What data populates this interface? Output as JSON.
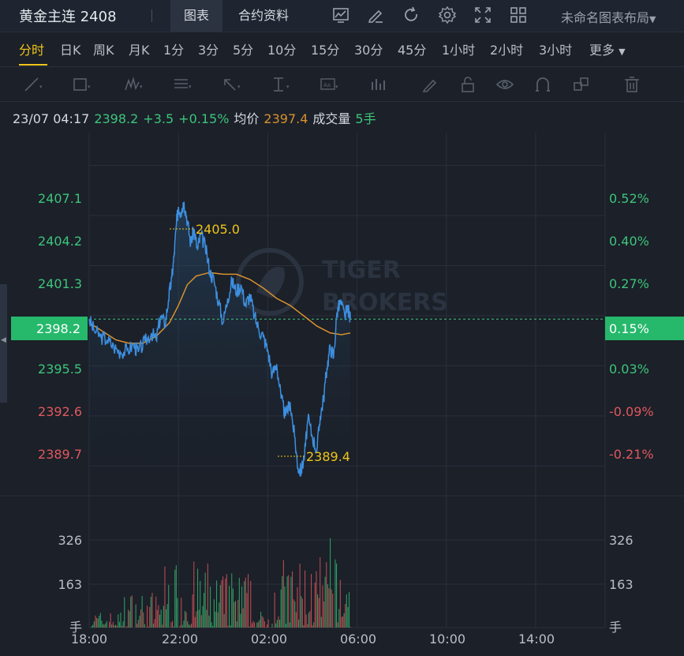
{
  "header": {
    "title": "黄金主连 2408",
    "tabs": [
      "图表",
      "合约资料"
    ],
    "active_tab": "图表",
    "icons": [
      "indicator-icon",
      "draw-icon",
      "refresh-icon",
      "settings-icon",
      "fullscreen-icon",
      "layout-grid-icon"
    ],
    "layout_name": "未命名图表布局"
  },
  "periods": [
    "分时",
    "日K",
    "周K",
    "月K",
    "1分",
    "3分",
    "5分",
    "10分",
    "15分",
    "30分",
    "45分",
    "1小时",
    "2小时",
    "3小时",
    "更多"
  ],
  "active_period": "分时",
  "drawing_tools": [
    "line-tool-icon",
    "rect-tool-icon",
    "wave-tool-icon",
    "fib-tool-icon",
    "arrow-tool-icon",
    "measure-tool-icon",
    "text-tool-icon",
    "bars-tool-icon",
    "pen-icon",
    "lock-icon",
    "eye-icon",
    "magnet-icon",
    "layers-icon",
    "trash-icon"
  ],
  "info_bar": {
    "datetime": "23/07 04:17",
    "price": "2398.2",
    "change": "+3.5",
    "change_pct": "+0.15%",
    "avg_label": "均价",
    "avg_value": "2397.4",
    "volume_label": "成交量",
    "volume_value": "5手"
  },
  "watermark": [
    "TIGER",
    "BROKERS"
  ],
  "colors": {
    "up": "#3ec47a",
    "down": "#e0585e",
    "price_line": "#3d8fe0",
    "avg_line": "#d9912e",
    "highlight": "#f0c419",
    "current_box": "#26b86b"
  },
  "chart_data": {
    "type": "line",
    "price_ticks_left": [
      "2407.1",
      "2404.2",
      "2401.3",
      "2398.2",
      "2395.5",
      "2392.6",
      "2389.7"
    ],
    "price_ticks_values": [
      2407.1,
      2404.2,
      2401.3,
      2398.4,
      2395.5,
      2392.6,
      2389.7
    ],
    "pct_ticks_right": [
      "0.52%",
      "0.40%",
      "0.27%",
      "0.15%",
      "0.03%",
      "-0.09%",
      "-0.21%"
    ],
    "current_price": "2398.2",
    "current_pct": "0.15%",
    "high_label": "2405.0",
    "low_label": "2389.4",
    "ylim": [
      2388.25,
      2409.0
    ],
    "x_labels": [
      "18:00",
      "22:00",
      "02:00",
      "06:00",
      "10:00",
      "14:00"
    ],
    "volume_ticks": [
      "326",
      "163"
    ],
    "volume_unit": "手",
    "price_series": [
      {
        "t": 18.0,
        "p": 2398.2
      },
      {
        "t": 18.2,
        "p": 2397.6
      },
      {
        "t": 18.5,
        "p": 2397.2
      },
      {
        "t": 18.8,
        "p": 2397.0
      },
      {
        "t": 19.1,
        "p": 2396.6
      },
      {
        "t": 19.4,
        "p": 2396.3
      },
      {
        "t": 19.7,
        "p": 2396.4
      },
      {
        "t": 20.0,
        "p": 2396.7
      },
      {
        "t": 20.2,
        "p": 2396.3
      },
      {
        "t": 20.5,
        "p": 2396.9
      },
      {
        "t": 20.8,
        "p": 2397.4
      },
      {
        "t": 21.0,
        "p": 2397.0
      },
      {
        "t": 21.2,
        "p": 2398.4
      },
      {
        "t": 21.4,
        "p": 2397.9
      },
      {
        "t": 21.55,
        "p": 2399.3
      },
      {
        "t": 21.7,
        "p": 2400.6
      },
      {
        "t": 21.8,
        "p": 2401.8
      },
      {
        "t": 21.9,
        "p": 2403.6
      },
      {
        "t": 22.0,
        "p": 2404.7
      },
      {
        "t": 22.1,
        "p": 2404.4
      },
      {
        "t": 22.25,
        "p": 2405.0
      },
      {
        "t": 22.4,
        "p": 2403.9
      },
      {
        "t": 22.55,
        "p": 2402.6
      },
      {
        "t": 22.7,
        "p": 2403.4
      },
      {
        "t": 22.85,
        "p": 2402.2
      },
      {
        "t": 23.0,
        "p": 2403.1
      },
      {
        "t": 23.2,
        "p": 2402.4
      },
      {
        "t": 23.4,
        "p": 2401.0
      },
      {
        "t": 23.6,
        "p": 2400.4
      },
      {
        "t": 23.8,
        "p": 2399.2
      },
      {
        "t": 24.0,
        "p": 2398.0
      },
      {
        "t": 24.2,
        "p": 2399.4
      },
      {
        "t": 24.4,
        "p": 2400.4
      },
      {
        "t": 24.6,
        "p": 2399.8
      },
      {
        "t": 24.8,
        "p": 2400.2
      },
      {
        "t": 25.0,
        "p": 2399.0
      },
      {
        "t": 25.2,
        "p": 2399.6
      },
      {
        "t": 25.4,
        "p": 2398.4
      },
      {
        "t": 25.6,
        "p": 2397.6
      },
      {
        "t": 25.8,
        "p": 2397.2
      },
      {
        "t": 26.0,
        "p": 2396.4
      },
      {
        "t": 26.2,
        "p": 2395.0
      },
      {
        "t": 26.4,
        "p": 2395.6
      },
      {
        "t": 26.6,
        "p": 2393.6
      },
      {
        "t": 26.8,
        "p": 2392.6
      },
      {
        "t": 27.0,
        "p": 2393.4
      },
      {
        "t": 27.2,
        "p": 2391.4
      },
      {
        "t": 27.35,
        "p": 2389.6
      },
      {
        "t": 27.5,
        "p": 2389.4
      },
      {
        "t": 27.65,
        "p": 2390.4
      },
      {
        "t": 27.8,
        "p": 2392.4
      },
      {
        "t": 28.0,
        "p": 2391.4
      },
      {
        "t": 28.2,
        "p": 2390.6
      },
      {
        "t": 28.35,
        "p": 2392.6
      },
      {
        "t": 28.5,
        "p": 2393.6
      },
      {
        "t": 28.65,
        "p": 2395.4
      },
      {
        "t": 28.8,
        "p": 2396.6
      },
      {
        "t": 28.95,
        "p": 2396.0
      },
      {
        "t": 29.1,
        "p": 2398.6
      },
      {
        "t": 29.25,
        "p": 2399.2
      },
      {
        "t": 29.45,
        "p": 2398.4
      },
      {
        "t": 29.6,
        "p": 2398.8
      },
      {
        "t": 29.7,
        "p": 2398.2
      }
    ],
    "avg_series": [
      {
        "t": 18.0,
        "p": 2398.0
      },
      {
        "t": 18.6,
        "p": 2397.5
      },
      {
        "t": 19.2,
        "p": 2397.0
      },
      {
        "t": 19.8,
        "p": 2396.8
      },
      {
        "t": 20.4,
        "p": 2396.8
      },
      {
        "t": 21.0,
        "p": 2397.2
      },
      {
        "t": 21.6,
        "p": 2398.0
      },
      {
        "t": 22.0,
        "p": 2399.0
      },
      {
        "t": 22.4,
        "p": 2400.2
      },
      {
        "t": 22.8,
        "p": 2400.7
      },
      {
        "t": 23.4,
        "p": 2400.9
      },
      {
        "t": 24.0,
        "p": 2400.8
      },
      {
        "t": 24.6,
        "p": 2400.8
      },
      {
        "t": 25.2,
        "p": 2400.5
      },
      {
        "t": 25.8,
        "p": 2400.0
      },
      {
        "t": 26.4,
        "p": 2399.4
      },
      {
        "t": 27.0,
        "p": 2399.0
      },
      {
        "t": 27.6,
        "p": 2398.4
      },
      {
        "t": 28.2,
        "p": 2397.8
      },
      {
        "t": 28.8,
        "p": 2397.4
      },
      {
        "t": 29.3,
        "p": 2397.3
      },
      {
        "t": 29.7,
        "p": 2397.4
      }
    ],
    "volume_max": 420,
    "volume_seed": 7
  }
}
